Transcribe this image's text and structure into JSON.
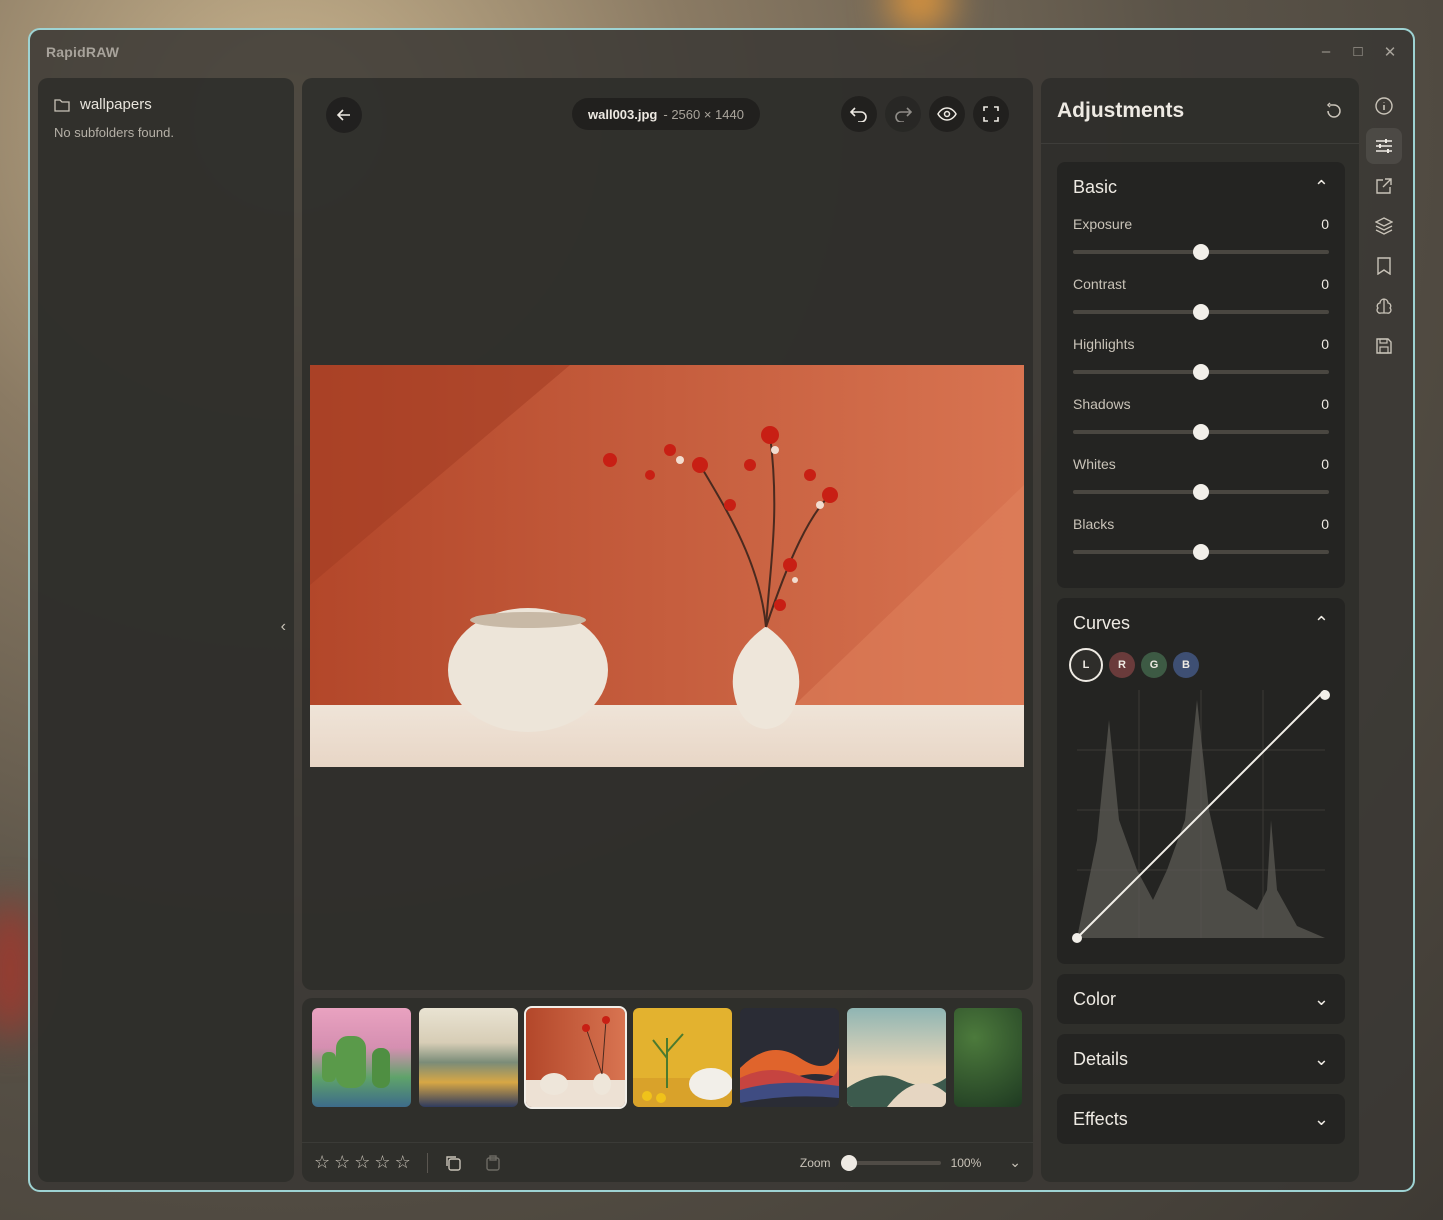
{
  "app": {
    "title": "RapidRAW"
  },
  "library": {
    "folder_name": "wallpapers",
    "empty_message": "No subfolders found."
  },
  "editor": {
    "file_name": "wall003.jpg",
    "file_dims": "- 2560 × 1440"
  },
  "adjustments": {
    "title": "Adjustments",
    "basic": {
      "title": "Basic",
      "sliders": [
        {
          "label": "Exposure",
          "value": "0"
        },
        {
          "label": "Contrast",
          "value": "0"
        },
        {
          "label": "Highlights",
          "value": "0"
        },
        {
          "label": "Shadows",
          "value": "0"
        },
        {
          "label": "Whites",
          "value": "0"
        },
        {
          "label": "Blacks",
          "value": "0"
        }
      ]
    },
    "curves": {
      "title": "Curves",
      "channels": [
        {
          "label": "L",
          "color": "#2e2d2a"
        },
        {
          "label": "R",
          "color": "#6a3b3b"
        },
        {
          "label": "G",
          "color": "#3d5a44"
        },
        {
          "label": "B",
          "color": "#3e4f73"
        }
      ]
    },
    "collapsed_sections": [
      "Color",
      "Details",
      "Effects"
    ]
  },
  "filmstrip": {
    "zoom_label": "Zoom",
    "zoom_value": "100%",
    "zoom_level": 0,
    "rating": 0,
    "active_index": 2
  },
  "icons": {
    "back": "arrow-left-icon",
    "undo": "undo-icon",
    "redo": "redo-icon",
    "preview": "eye-icon",
    "fullscreen": "fullscreen-icon",
    "reset": "reset-icon"
  },
  "colors": {
    "accent_border": "#9ed3d3",
    "panel": "#2e2d2a"
  }
}
